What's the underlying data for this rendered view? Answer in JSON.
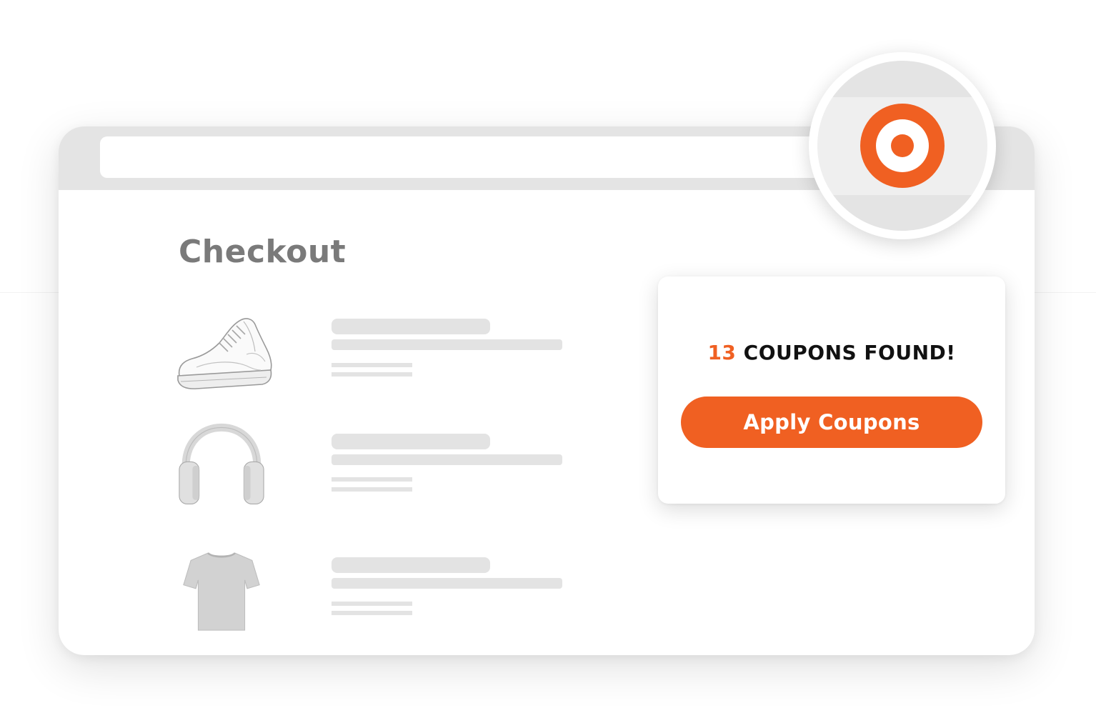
{
  "checkout": {
    "title": "Checkout"
  },
  "products": [
    {
      "icon": "sneaker-icon"
    },
    {
      "icon": "headphones-icon"
    },
    {
      "icon": "tshirt-icon"
    }
  ],
  "coupon_popup": {
    "count": "13",
    "found_text": " COUPONS FOUND!",
    "button_label": "Apply Coupons"
  },
  "extension": {
    "icon": "target-logo-icon"
  },
  "colors": {
    "accent": "#f06022",
    "title_gray": "#7a7a7a",
    "placeholder": "#e3e3e3",
    "chrome": "#e4e4e4"
  }
}
